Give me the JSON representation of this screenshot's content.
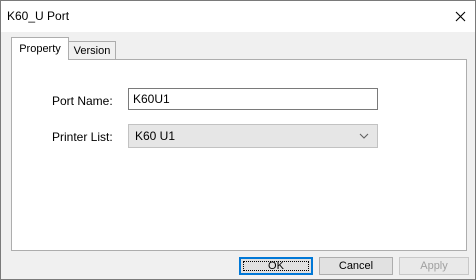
{
  "window": {
    "title": "K60_U Port"
  },
  "tabs": [
    {
      "label": "Property",
      "active": true
    },
    {
      "label": "Version",
      "active": false
    }
  ],
  "form": {
    "port_name_label": "Port Name:",
    "port_name_value": "K60U1",
    "printer_list_label": "Printer List:",
    "printer_list_value": "K60 U1"
  },
  "buttons": {
    "ok": "OK",
    "cancel": "Cancel",
    "apply": "Apply"
  },
  "icons": {
    "close": "close-icon",
    "dropdown": "chevron-down-icon"
  }
}
